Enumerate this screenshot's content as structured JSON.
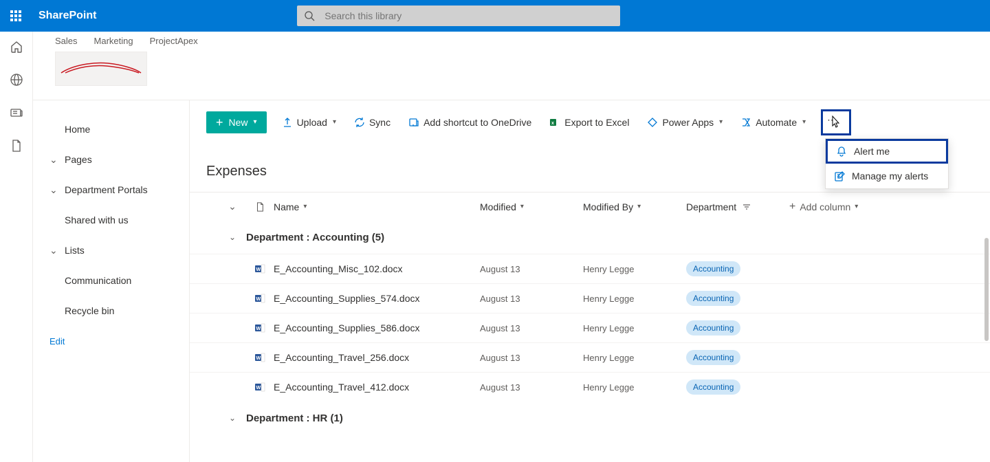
{
  "suite": {
    "app_name": "SharePoint",
    "search_placeholder": "Search this library"
  },
  "hub_links": [
    "Sales",
    "Marketing",
    "ProjectApex"
  ],
  "left_nav": {
    "home": "Home",
    "pages": "Pages",
    "dept": "Department Portals",
    "shared": "Shared with us",
    "lists": "Lists",
    "comm": "Communication",
    "recycle": "Recycle bin",
    "edit": "Edit"
  },
  "cmd": {
    "new": "New",
    "upload": "Upload",
    "sync": "Sync",
    "shortcut": "Add shortcut to OneDrive",
    "export": "Export to Excel",
    "powerapps": "Power Apps",
    "automate": "Automate"
  },
  "dropdown": {
    "alert_me": "Alert me",
    "manage_alerts": "Manage my alerts"
  },
  "library": {
    "title": "Expenses",
    "cols": {
      "name": "Name",
      "modified": "Modified",
      "modified_by": "Modified By",
      "department": "Department",
      "add": "Add column"
    },
    "groups": [
      {
        "label": "Department : Accounting (5)",
        "rows": [
          {
            "name": "E_Accounting_Misc_102.docx",
            "modified": "August 13",
            "modified_by": "Henry Legge",
            "dept": "Accounting"
          },
          {
            "name": "E_Accounting_Supplies_574.docx",
            "modified": "August 13",
            "modified_by": "Henry Legge",
            "dept": "Accounting"
          },
          {
            "name": "E_Accounting_Supplies_586.docx",
            "modified": "August 13",
            "modified_by": "Henry Legge",
            "dept": "Accounting"
          },
          {
            "name": "E_Accounting_Travel_256.docx",
            "modified": "August 13",
            "modified_by": "Henry Legge",
            "dept": "Accounting"
          },
          {
            "name": "E_Accounting_Travel_412.docx",
            "modified": "August 13",
            "modified_by": "Henry Legge",
            "dept": "Accounting"
          }
        ]
      },
      {
        "label": "Department : HR (1)",
        "rows": []
      }
    ]
  },
  "colors": {
    "accent": "#0078d4",
    "new_btn": "#00a99d",
    "highlight_border": "#0a3a9e"
  }
}
